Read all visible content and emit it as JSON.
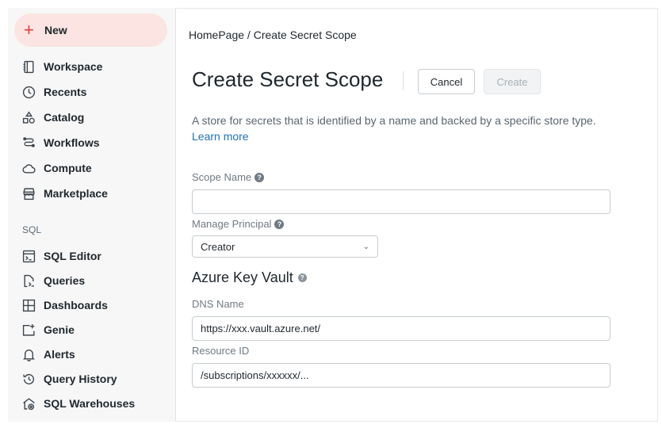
{
  "sidebar": {
    "new_label": "New",
    "items": [
      {
        "label": "Workspace"
      },
      {
        "label": "Recents"
      },
      {
        "label": "Catalog"
      },
      {
        "label": "Workflows"
      },
      {
        "label": "Compute"
      },
      {
        "label": "Marketplace"
      }
    ],
    "sql_section": "SQL",
    "sql_items": [
      {
        "label": "SQL Editor"
      },
      {
        "label": "Queries"
      },
      {
        "label": "Dashboards"
      },
      {
        "label": "Genie"
      },
      {
        "label": "Alerts"
      },
      {
        "label": "Query History"
      },
      {
        "label": "SQL Warehouses"
      }
    ]
  },
  "breadcrumb": {
    "home": "HomePage",
    "sep": " / ",
    "current": "Create Secret Scope"
  },
  "header": {
    "title": "Create Secret Scope",
    "cancel_label": "Cancel",
    "create_label": "Create"
  },
  "description": {
    "text": "A store for secrets that is identified by a name and backed by a specific store type. ",
    "link": "Learn more"
  },
  "form": {
    "scope_name_label": "Scope Name",
    "scope_name_value": "",
    "manage_principal_label": "Manage Principal",
    "manage_principal_value": "Creator",
    "akv_section": "Azure Key Vault",
    "dns_label": "DNS Name",
    "dns_value": "https://xxx.vault.azure.net/",
    "resource_label": "Resource ID",
    "resource_value": "/subscriptions/xxxxxx/..."
  },
  "colors": {
    "accent": "#e23c3c",
    "link": "#2272b4",
    "new_bg": "#fbe4e1"
  }
}
